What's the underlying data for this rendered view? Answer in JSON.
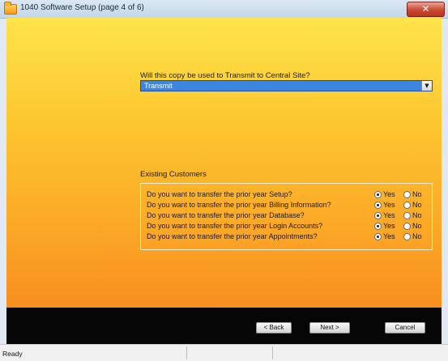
{
  "window": {
    "title": "1040 Software Setup (page 4 of 6)",
    "close_label": "✕"
  },
  "transmit": {
    "question": "Will this copy be used to Transmit to Central Site?",
    "selected_value": "Transmit",
    "dropdown_icon": "chevron-down-icon"
  },
  "existing_customers": {
    "heading": "Existing Customers",
    "questions": [
      {
        "text": "Do you want to transfer the prior year Setup?",
        "yes_label": "Yes",
        "no_label": "No",
        "selected": "Yes"
      },
      {
        "text": "Do you want to transfer the prior year Billing Information?",
        "yes_label": "Yes",
        "no_label": "No",
        "selected": "Yes"
      },
      {
        "text": "Do you want to transfer the prior year Database?",
        "yes_label": "Yes",
        "no_label": "No",
        "selected": "Yes"
      },
      {
        "text": "Do you want to transfer the prior year Login Accounts?",
        "yes_label": "Yes",
        "no_label": "No",
        "selected": "Yes"
      },
      {
        "text": "Do you want to transfer the prior year Appointments?",
        "yes_label": "Yes",
        "no_label": "No",
        "selected": "Yes"
      }
    ]
  },
  "buttons": {
    "back_label": "< Back",
    "next_label": "Next >",
    "cancel_label": "Cancel"
  },
  "status": {
    "text": "Ready"
  },
  "colors": {
    "gradient_top": "#fde34a",
    "gradient_bottom": "#f88e1e",
    "dropdown_selection": "#3c86e2",
    "button_bar": "#060606"
  }
}
